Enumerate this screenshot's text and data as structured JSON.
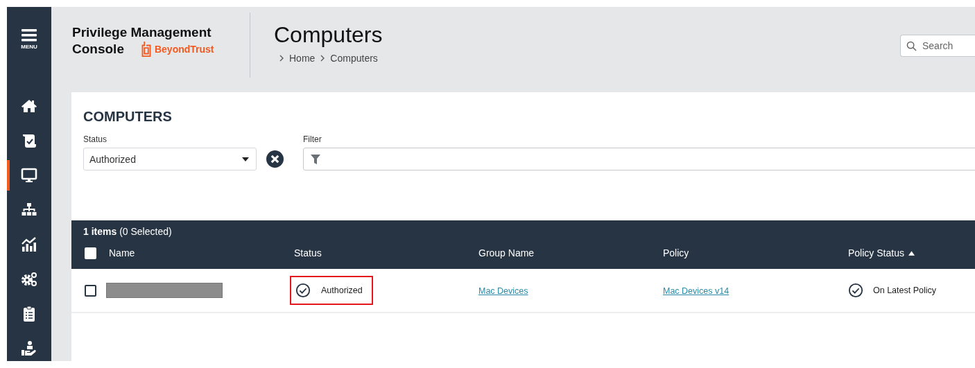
{
  "sidebar": {
    "menu_label": "MENU",
    "items": [
      {
        "kind": "home",
        "selected": false
      },
      {
        "kind": "scroll",
        "selected": false
      },
      {
        "kind": "monitor",
        "selected": true
      },
      {
        "kind": "sitemap",
        "selected": false
      },
      {
        "kind": "chart",
        "selected": false
      },
      {
        "kind": "gears",
        "selected": false
      },
      {
        "kind": "clipboard",
        "selected": false
      },
      {
        "kind": "hand",
        "selected": false
      }
    ]
  },
  "header": {
    "product_title": [
      "Privilege Management",
      "Console"
    ],
    "logo_text": "BeyondTrust",
    "page_title": "Computers",
    "breadcrumb": [
      "Home",
      "Computers"
    ],
    "search": {
      "placeholder": "Search"
    }
  },
  "panel": {
    "title": "COMPUTERS",
    "status_filter": {
      "label": "Status",
      "value": "Authorized"
    },
    "filter": {
      "label": "Filter"
    }
  },
  "table": {
    "count": "1 items",
    "selection": "(0 Selected)",
    "select_all": {
      "checked": false
    },
    "columns": [
      {
        "label": "Name",
        "sorted_ascending": false
      },
      {
        "label": "Status",
        "sorted_ascending": false
      },
      {
        "label": "Group Name",
        "sorted_ascending": false
      },
      {
        "label": "Policy",
        "sorted_ascending": false
      },
      {
        "label": "Policy Status",
        "sorted_ascending": true
      }
    ],
    "rows": [
      {
        "checked": false,
        "name_redacted": true,
        "status": "Authorized",
        "status_highlighted": true,
        "group": "Mac Devices",
        "policy": "Mac Devices v14",
        "policy_status": "On Latest Policy"
      }
    ]
  }
}
